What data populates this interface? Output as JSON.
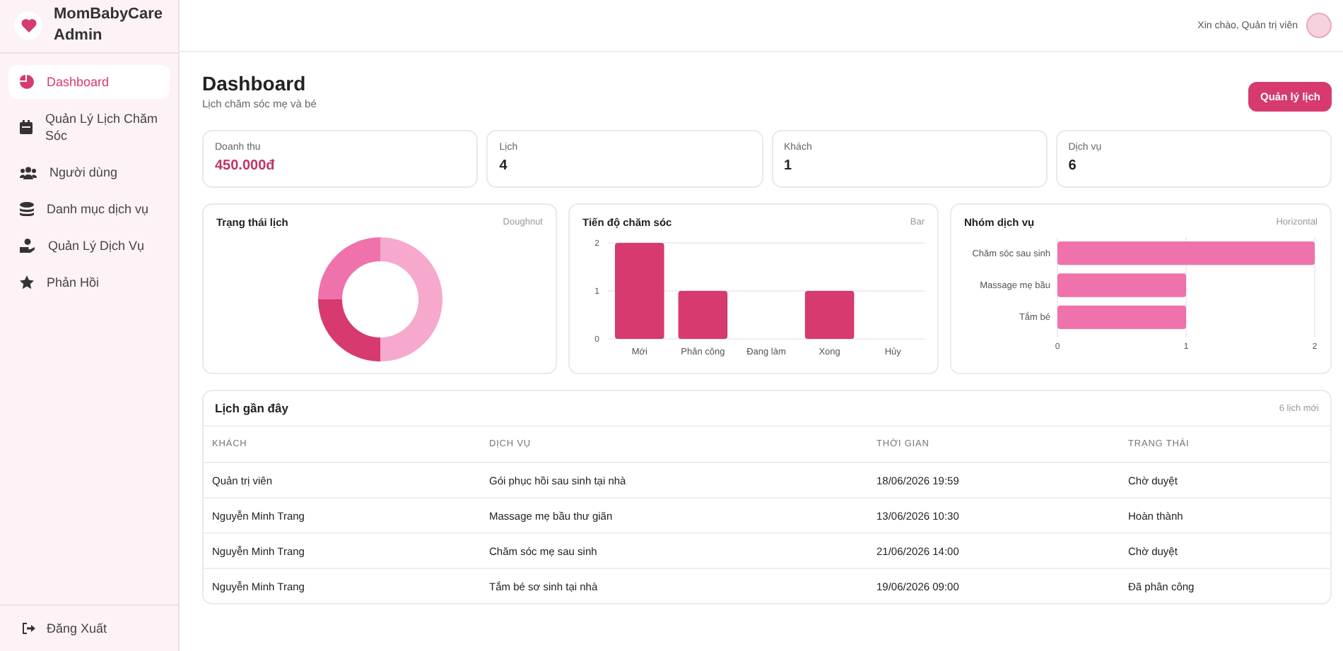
{
  "sidebar": {
    "brand": "MomBabyCare Admin",
    "items": [
      {
        "label": "Dashboard",
        "selected": true
      },
      {
        "label": "Quản Lý Lịch Chăm Sóc",
        "selected": false
      },
      {
        "label": "Người dùng",
        "selected": false
      },
      {
        "label": "Danh mục dịch vụ",
        "selected": false
      },
      {
        "label": "Quản Lý Dịch Vụ",
        "selected": false
      },
      {
        "label": "Phản Hồi",
        "selected": false
      }
    ],
    "logout": "Đăng Xuất"
  },
  "header": {
    "greeting": "Xin chào, Quản trị viên"
  },
  "page": {
    "title": "Dashboard",
    "subtitle": "Lịch chăm sóc mẹ và bé",
    "action": "Quản lý lịch"
  },
  "stats": [
    {
      "label": "Doanh thu",
      "value": "450.000đ",
      "kind": "money"
    },
    {
      "label": "Lịch",
      "value": "4",
      "kind": "count"
    },
    {
      "label": "Khách",
      "value": "1",
      "kind": "count"
    },
    {
      "label": "Dịch vụ",
      "value": "6",
      "kind": "count"
    }
  ],
  "charts": [
    {
      "title": "Trạng thái lịch",
      "tag": "Doughnut",
      "kind": "donut"
    },
    {
      "title": "Tiến độ chăm sóc",
      "tag": "Bar",
      "kind": "bar",
      "chart_data": {
        "type": "bar",
        "categories": [
          "Mới",
          "Phân công",
          "Đang làm",
          "Xong",
          "Hủy"
        ],
        "values": [
          2,
          1,
          0,
          1,
          0
        ],
        "yticks": [
          0,
          1,
          2
        ],
        "ylim": [
          0,
          2
        ],
        "orientation": "vertical"
      }
    },
    {
      "title": "Nhóm dịch vụ",
      "tag": "Horizontal",
      "kind": "hbar",
      "chart_data": {
        "type": "bar",
        "categories": [
          "Chăm sóc sau sinh",
          "Massage mẹ bầu",
          "Tắm bé"
        ],
        "values": [
          2,
          1,
          1
        ],
        "xticks": [
          0,
          1,
          2
        ],
        "xlim": [
          0,
          2
        ],
        "orientation": "horizontal"
      }
    }
  ],
  "recent": {
    "title": "Lịch gần đây",
    "count": "6 lịch mới",
    "columns": [
      "KHÁCH",
      "DỊCH VỤ",
      "THỜI GIAN",
      "TRẠNG THÁI"
    ],
    "rows": [
      [
        "Quản trị viên",
        "Gói phục hồi sau sinh tại nhà",
        "18/06/2026 19:59",
        "Chờ duyệt"
      ],
      [
        "Nguyễn Minh Trang",
        "Massage mẹ bầu thư giãn",
        "13/06/2026 10:30",
        "Hoàn thành"
      ],
      [
        "Nguyễn Minh Trang",
        "Chăm sóc mẹ sau sinh",
        "21/06/2026 14:00",
        "Chờ duyệt"
      ],
      [
        "Nguyễn Minh Trang",
        "Tắm bé sơ sinh tại nhà",
        "19/06/2026 09:00",
        "Đã phân công"
      ]
    ]
  }
}
